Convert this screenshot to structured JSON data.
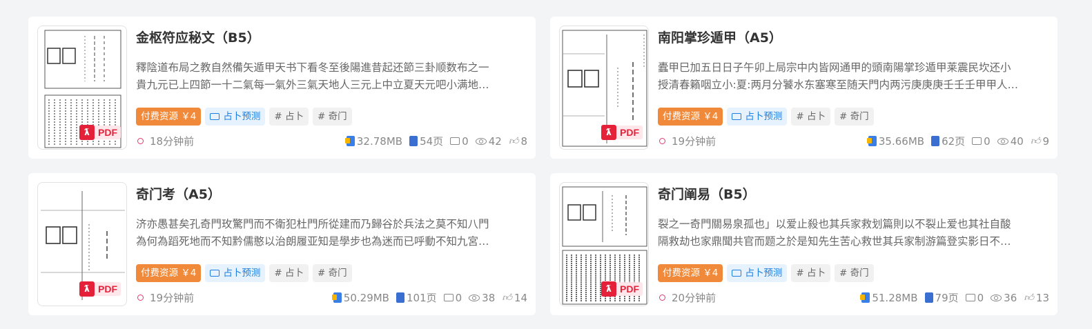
{
  "cards": [
    {
      "title": "金枢符应秘文（B5）",
      "desc_line1": "釋陰道布局之教自然備矢遁甲天书下看冬至後陽進昔起还節三卦顺数布之一",
      "desc_line2": "貴九元已上四節一十二氣每一氣外三氣天地人三元上中立夏天元吧小满地…",
      "paid_tag": "付费资源 ￥4",
      "category_tag": "占卜预测",
      "tag1": "# 占卜",
      "tag2": "# 奇门",
      "time": "18分钟前",
      "size": "32.78MB",
      "pages": "54页",
      "comments": "0",
      "views": "42",
      "likes": "8",
      "pdf_label": "PDF"
    },
    {
      "title": "南阳掌珍遁甲（A5）",
      "desc_line1": "蠹甲巳加五日日子午卯上局宗中内皆网通甲的頭南陽掌珍遁甲莱震民坎还小",
      "desc_line2": "授清春籟咽立小:夏:两月分饕水东塞寒至随天門内两污庚庚庚壬壬壬甲甲人…",
      "paid_tag": "付费资源 ￥4",
      "category_tag": "占卜预测",
      "tag1": "# 占卜",
      "tag2": "# 奇门",
      "time": "19分钟前",
      "size": "35.66MB",
      "pages": "62页",
      "comments": "0",
      "views": "40",
      "likes": "9",
      "pdf_label": "PDF"
    },
    {
      "title": "奇门考（A5）",
      "desc_line1": "济亦愚甚矣孔奇門玫驚門而不衛犯杜門所從建而乃歸谷於兵法之莫不知八門",
      "desc_line2": "為何為蹈死地而不知黔儒憨以治朗履亚知是學步也為迷而已呼動不知九宮…",
      "paid_tag": "付费资源 ￥4",
      "category_tag": "占卜预测",
      "tag1": "# 占卜",
      "tag2": "# 奇门",
      "time": "19分钟前",
      "size": "50.29MB",
      "pages": "101页",
      "comments": "0",
      "views": "38",
      "likes": "14",
      "pdf_label": "PDF"
    },
    {
      "title": "奇门阐易（B5）",
      "desc_line1": "裂之一奇門關易泉孤也」以爱止殺也其兵家救划篇則以不裂止爱也其社自酸",
      "desc_line2": "隔救劫也家鼎聞共官而题之於是知先生苦心救世其兵家制游篇登实影日不…",
      "paid_tag": "付费资源 ￥4",
      "category_tag": "占卜预测",
      "tag1": "# 占卜",
      "tag2": "# 奇门",
      "time": "20分钟前",
      "size": "51.28MB",
      "pages": "79页",
      "comments": "0",
      "views": "36",
      "likes": "13",
      "pdf_label": "PDF"
    }
  ],
  "colors": {
    "paid": "#f08a3a",
    "category": "#1d7ee0",
    "pdf": "#e5213a",
    "background": "#f3f4f6"
  },
  "icons": {
    "time": "circle-dot-icon",
    "size": "file-size-icon",
    "pages": "document-pages-icon",
    "comments": "comment-icon",
    "views": "eye-icon",
    "likes": "thumbs-up-icon",
    "category": "folder-icon",
    "pdf": "pdf-icon"
  }
}
